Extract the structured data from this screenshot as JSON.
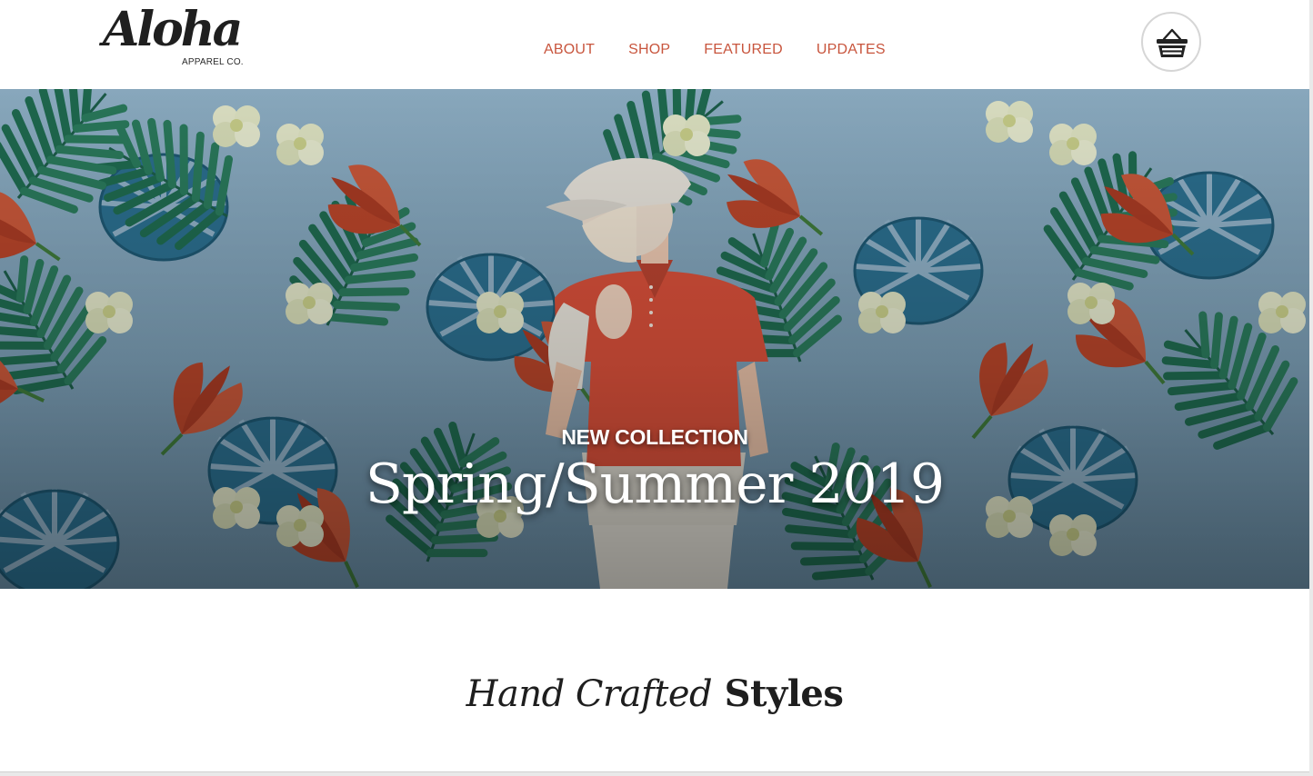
{
  "brand": {
    "name": "Aloha",
    "subtitle": "APPAREL CO."
  },
  "nav": {
    "items": [
      {
        "label": "ABOUT"
      },
      {
        "label": "SHOP"
      },
      {
        "label": "FEATURED"
      },
      {
        "label": "UPDATES"
      }
    ]
  },
  "cart": {
    "icon": "shopping-basket-icon"
  },
  "hero": {
    "eyebrow": "NEW COLLECTION",
    "title": "Spring/Summer 2019"
  },
  "section": {
    "title_italic": "Hand Crafted",
    "title_bold": "Styles"
  },
  "colors": {
    "nav_accent": "#c8553d",
    "hero_sky": "#7fa3ba",
    "leaf_dark": "#1f6a55",
    "leaf_blue": "#2b6f8f",
    "flower_red": "#b8452a",
    "flower_cream": "#e3e7c9",
    "shirt_red": "#d9503a"
  }
}
